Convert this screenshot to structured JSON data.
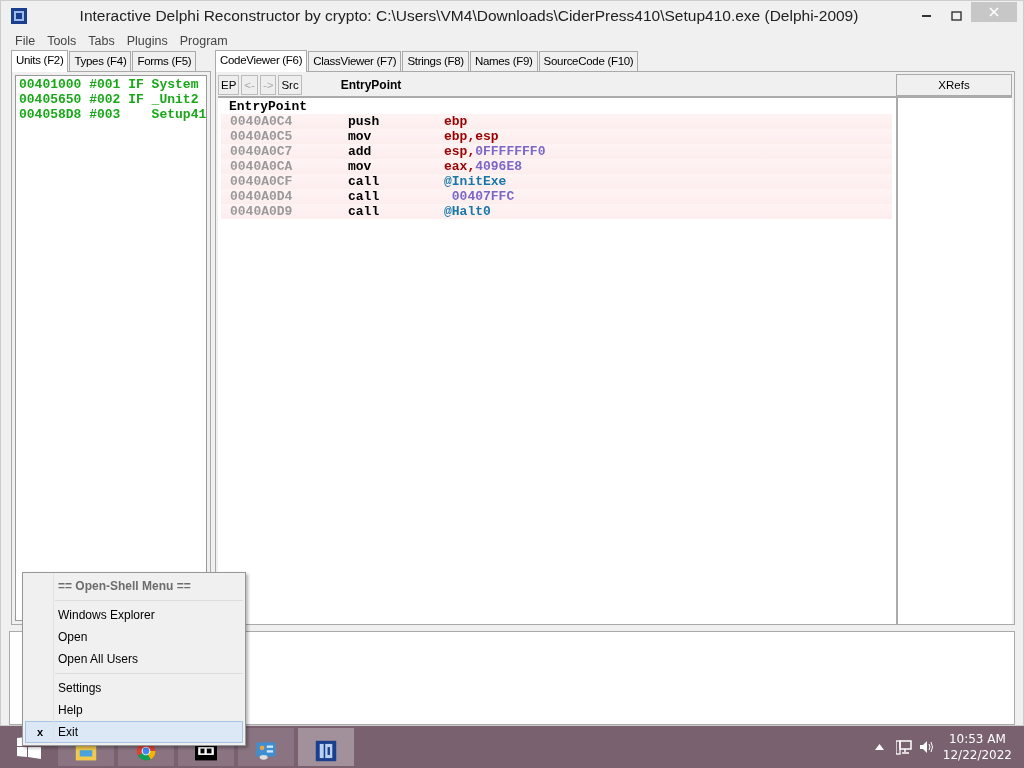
{
  "window": {
    "title": "Interactive Delphi Reconstructor by crypto: C:\\Users\\VM4\\Downloads\\CiderPress410\\Setup410.exe (Delphi-2009)"
  },
  "menu_bar": [
    "File",
    "Tools",
    "Tabs",
    "Plugins",
    "Program"
  ],
  "left_tabs": [
    {
      "label": "Units (F2)",
      "selected": true
    },
    {
      "label": "Types (F4)",
      "selected": false
    },
    {
      "label": "Forms (F5)",
      "selected": false
    }
  ],
  "units": [
    "00401000 #001 IF System",
    "00405650 #002 IF _Unit2",
    "004058D8 #003    Setup41"
  ],
  "right_tabs": [
    {
      "label": "CodeViewer (F6)",
      "selected": true
    },
    {
      "label": "ClassViewer (F7)",
      "selected": false
    },
    {
      "label": "Strings (F8)",
      "selected": false
    },
    {
      "label": "Names (F9)",
      "selected": false
    },
    {
      "label": "SourceCode (F10)",
      "selected": false
    }
  ],
  "toolbar": [
    {
      "label": "EP",
      "disabled": false
    },
    {
      "label": "<-",
      "disabled": true
    },
    {
      "label": "->",
      "disabled": true
    },
    {
      "label": "Src",
      "disabled": false
    }
  ],
  "procedure_name": "EntryPoint",
  "xrefs_header": "XRefs",
  "code": {
    "title": "EntryPoint",
    "lines": [
      {
        "address": "0040A0C4",
        "mnemonic": "push",
        "operand": [
          {
            "kind": "reg",
            "text": "ebp"
          }
        ]
      },
      {
        "address": "0040A0C5",
        "mnemonic": "mov",
        "operand": [
          {
            "kind": "reg",
            "text": "ebp,esp"
          }
        ]
      },
      {
        "address": "0040A0C7",
        "mnemonic": "add",
        "operand": [
          {
            "kind": "reg",
            "text": "esp,"
          },
          {
            "kind": "num",
            "text": "0FFFFFFF0"
          }
        ]
      },
      {
        "address": "0040A0CA",
        "mnemonic": "mov",
        "operand": [
          {
            "kind": "reg",
            "text": "eax,"
          },
          {
            "kind": "num",
            "text": "4096E8"
          }
        ]
      },
      {
        "address": "0040A0CF",
        "mnemonic": "call",
        "operand": [
          {
            "kind": "sym",
            "text": "@InitExe"
          }
        ]
      },
      {
        "address": "0040A0D4",
        "mnemonic": "call",
        "operand": [
          {
            "kind": "num",
            "text": " 00407FFC"
          }
        ]
      },
      {
        "address": "0040A0D9",
        "mnemonic": "call",
        "operand": [
          {
            "kind": "sym",
            "text": "@Halt0"
          }
        ]
      }
    ]
  },
  "context_menu": [
    {
      "kind": "header",
      "label": "== Open-Shell Menu =="
    },
    {
      "kind": "separator"
    },
    {
      "kind": "item",
      "label": "Windows Explorer",
      "selected": false
    },
    {
      "kind": "item",
      "label": "Open",
      "selected": false
    },
    {
      "kind": "item",
      "label": "Open All Users",
      "selected": false
    },
    {
      "kind": "separator"
    },
    {
      "kind": "item",
      "label": "Settings",
      "selected": false
    },
    {
      "kind": "item",
      "label": "Help",
      "selected": false
    },
    {
      "kind": "item",
      "label": "Exit",
      "selected": true,
      "mark": "x"
    }
  ],
  "taskbar": {
    "apps": [
      {
        "kind": "explorer",
        "selected": false
      },
      {
        "kind": "chrome",
        "selected": false
      },
      {
        "kind": "sevenzip",
        "selected": false
      },
      {
        "kind": "control",
        "selected": false
      },
      {
        "kind": "idr",
        "selected": true
      }
    ],
    "clock": {
      "time": "10:53 AM",
      "date": "12/22/2022"
    }
  }
}
